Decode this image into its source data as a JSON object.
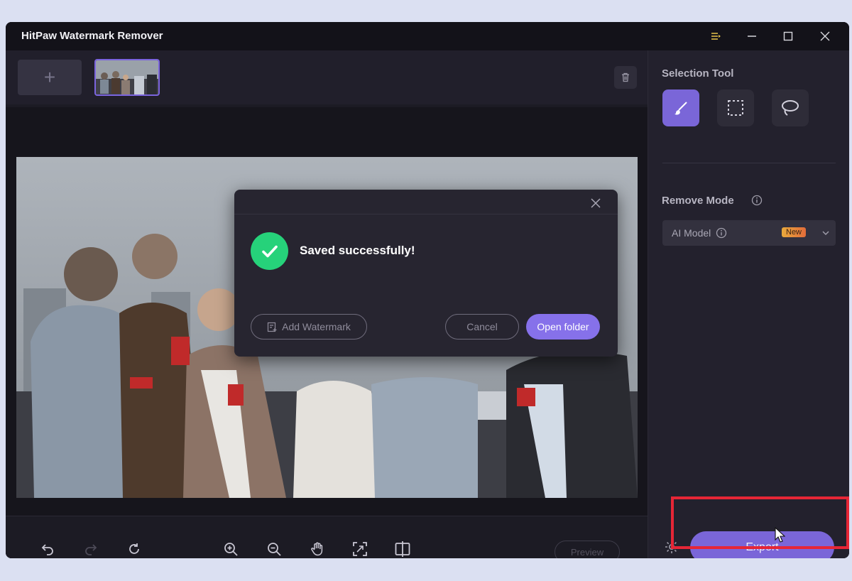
{
  "window": {
    "title": "HitPaw Watermark Remover"
  },
  "toolbar": {
    "add_symbol": "+"
  },
  "video": {
    "progress_fraction": 0.94
  },
  "bottom": {
    "preview_label": "Preview"
  },
  "panel": {
    "selection_title": "Selection Tool",
    "remove_mode_title": "Remove Mode",
    "mode_value": "AI Model",
    "badge_new": "New",
    "export_label": "Export"
  },
  "dialog": {
    "message": "Saved successfully!",
    "add_watermark_label": "Add Watermark",
    "cancel_label": "Cancel",
    "open_folder_label": "Open folder"
  },
  "colors": {
    "accent": "#7a66d8",
    "success": "#26d27a",
    "highlight": "#e62636"
  }
}
